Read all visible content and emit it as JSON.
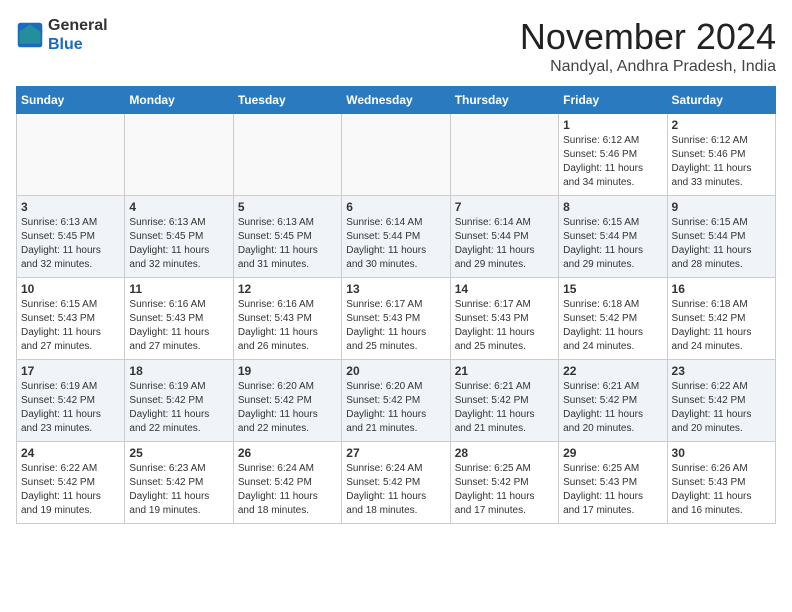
{
  "logo": {
    "general": "General",
    "blue": "Blue"
  },
  "title": "November 2024",
  "location": "Nandyal, Andhra Pradesh, India",
  "weekdays": [
    "Sunday",
    "Monday",
    "Tuesday",
    "Wednesday",
    "Thursday",
    "Friday",
    "Saturday"
  ],
  "weeks": [
    [
      {
        "day": "",
        "info": ""
      },
      {
        "day": "",
        "info": ""
      },
      {
        "day": "",
        "info": ""
      },
      {
        "day": "",
        "info": ""
      },
      {
        "day": "",
        "info": ""
      },
      {
        "day": "1",
        "info": "Sunrise: 6:12 AM\nSunset: 5:46 PM\nDaylight: 11 hours\nand 34 minutes."
      },
      {
        "day": "2",
        "info": "Sunrise: 6:12 AM\nSunset: 5:46 PM\nDaylight: 11 hours\nand 33 minutes."
      }
    ],
    [
      {
        "day": "3",
        "info": "Sunrise: 6:13 AM\nSunset: 5:45 PM\nDaylight: 11 hours\nand 32 minutes."
      },
      {
        "day": "4",
        "info": "Sunrise: 6:13 AM\nSunset: 5:45 PM\nDaylight: 11 hours\nand 32 minutes."
      },
      {
        "day": "5",
        "info": "Sunrise: 6:13 AM\nSunset: 5:45 PM\nDaylight: 11 hours\nand 31 minutes."
      },
      {
        "day": "6",
        "info": "Sunrise: 6:14 AM\nSunset: 5:44 PM\nDaylight: 11 hours\nand 30 minutes."
      },
      {
        "day": "7",
        "info": "Sunrise: 6:14 AM\nSunset: 5:44 PM\nDaylight: 11 hours\nand 29 minutes."
      },
      {
        "day": "8",
        "info": "Sunrise: 6:15 AM\nSunset: 5:44 PM\nDaylight: 11 hours\nand 29 minutes."
      },
      {
        "day": "9",
        "info": "Sunrise: 6:15 AM\nSunset: 5:44 PM\nDaylight: 11 hours\nand 28 minutes."
      }
    ],
    [
      {
        "day": "10",
        "info": "Sunrise: 6:15 AM\nSunset: 5:43 PM\nDaylight: 11 hours\nand 27 minutes."
      },
      {
        "day": "11",
        "info": "Sunrise: 6:16 AM\nSunset: 5:43 PM\nDaylight: 11 hours\nand 27 minutes."
      },
      {
        "day": "12",
        "info": "Sunrise: 6:16 AM\nSunset: 5:43 PM\nDaylight: 11 hours\nand 26 minutes."
      },
      {
        "day": "13",
        "info": "Sunrise: 6:17 AM\nSunset: 5:43 PM\nDaylight: 11 hours\nand 25 minutes."
      },
      {
        "day": "14",
        "info": "Sunrise: 6:17 AM\nSunset: 5:43 PM\nDaylight: 11 hours\nand 25 minutes."
      },
      {
        "day": "15",
        "info": "Sunrise: 6:18 AM\nSunset: 5:42 PM\nDaylight: 11 hours\nand 24 minutes."
      },
      {
        "day": "16",
        "info": "Sunrise: 6:18 AM\nSunset: 5:42 PM\nDaylight: 11 hours\nand 24 minutes."
      }
    ],
    [
      {
        "day": "17",
        "info": "Sunrise: 6:19 AM\nSunset: 5:42 PM\nDaylight: 11 hours\nand 23 minutes."
      },
      {
        "day": "18",
        "info": "Sunrise: 6:19 AM\nSunset: 5:42 PM\nDaylight: 11 hours\nand 22 minutes."
      },
      {
        "day": "19",
        "info": "Sunrise: 6:20 AM\nSunset: 5:42 PM\nDaylight: 11 hours\nand 22 minutes."
      },
      {
        "day": "20",
        "info": "Sunrise: 6:20 AM\nSunset: 5:42 PM\nDaylight: 11 hours\nand 21 minutes."
      },
      {
        "day": "21",
        "info": "Sunrise: 6:21 AM\nSunset: 5:42 PM\nDaylight: 11 hours\nand 21 minutes."
      },
      {
        "day": "22",
        "info": "Sunrise: 6:21 AM\nSunset: 5:42 PM\nDaylight: 11 hours\nand 20 minutes."
      },
      {
        "day": "23",
        "info": "Sunrise: 6:22 AM\nSunset: 5:42 PM\nDaylight: 11 hours\nand 20 minutes."
      }
    ],
    [
      {
        "day": "24",
        "info": "Sunrise: 6:22 AM\nSunset: 5:42 PM\nDaylight: 11 hours\nand 19 minutes."
      },
      {
        "day": "25",
        "info": "Sunrise: 6:23 AM\nSunset: 5:42 PM\nDaylight: 11 hours\nand 19 minutes."
      },
      {
        "day": "26",
        "info": "Sunrise: 6:24 AM\nSunset: 5:42 PM\nDaylight: 11 hours\nand 18 minutes."
      },
      {
        "day": "27",
        "info": "Sunrise: 6:24 AM\nSunset: 5:42 PM\nDaylight: 11 hours\nand 18 minutes."
      },
      {
        "day": "28",
        "info": "Sunrise: 6:25 AM\nSunset: 5:42 PM\nDaylight: 11 hours\nand 17 minutes."
      },
      {
        "day": "29",
        "info": "Sunrise: 6:25 AM\nSunset: 5:43 PM\nDaylight: 11 hours\nand 17 minutes."
      },
      {
        "day": "30",
        "info": "Sunrise: 6:26 AM\nSunset: 5:43 PM\nDaylight: 11 hours\nand 16 minutes."
      }
    ]
  ]
}
